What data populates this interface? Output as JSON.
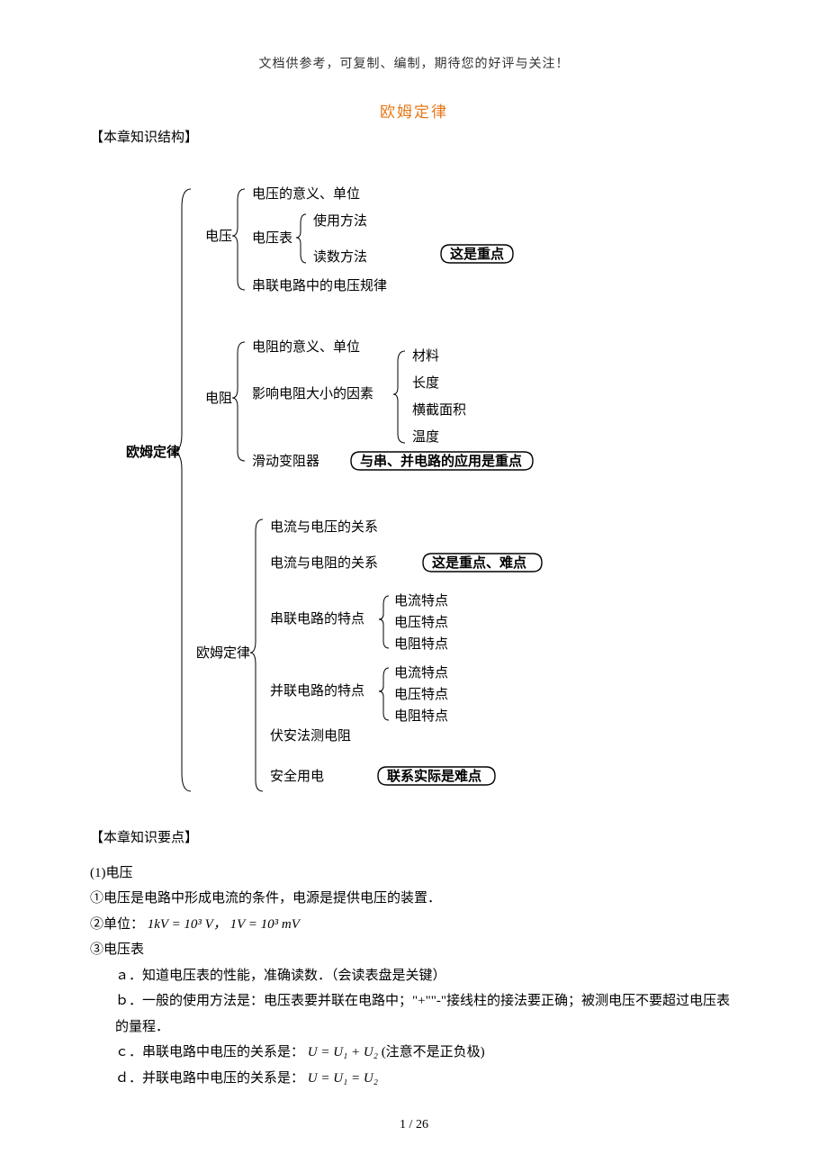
{
  "header_note": "文档供参考，可复制、编制，期待您的好评与关注！",
  "title": "欧姆定律",
  "section1_title": "【本章知识结构】",
  "diagram": {
    "root": "欧姆定律",
    "voltage": {
      "label": "电压",
      "item1": "电压的意义、单位",
      "meter_label": "电压表",
      "meter_a": "使用方法",
      "meter_b": "读数方法",
      "box1": "这是重点",
      "item3": "串联电路中的电压规律"
    },
    "resistance": {
      "label": "电阻",
      "item1": "电阻的意义、单位",
      "factors_label": "影响电阻大小的因素",
      "f1": "材料",
      "f2": "长度",
      "f3": "横截面积",
      "f4": "温度",
      "slider": "滑动变阻器",
      "box2": "与串、并电路的应用是重点"
    },
    "ohm": {
      "label": "欧姆定律",
      "rel1": "电流与电压的关系",
      "rel2": "电流与电阻的关系",
      "box3": "这是重点、难点",
      "series_label": "串联电路的特点",
      "parallel_label": "并联电路的特点",
      "p1": "电流特点",
      "p2": "电压特点",
      "p3": "电阻特点",
      "va": "伏安法测电阻",
      "safe": "安全用电",
      "box4": "联系实际是难点"
    }
  },
  "section2_title": "【本章知识要点】",
  "body": {
    "l1": "(1)电压",
    "l2": "①电压是电路中形成电流的条件，电源是提供电压的装置．",
    "l3_prefix": "②单位：",
    "l3_formula": "1kV = 10³ V， 1V = 10³ mV",
    "l4": "③电压表",
    "l5": "ａ．知道电压表的性能，准确读数．（会读表盘是关键）",
    "l6": "ｂ．一般的使用方法是：电压表要并联在电路中；\"+\"\"-\"接线柱的接法要正确；被测电压不要超过电压表的量程．",
    "l7_prefix": "ｃ．串联电路中电压的关系是：",
    "l7_formula": "U = U₁ + U₂",
    "l7_suffix": "(注意不是正负极)",
    "l8_prefix": "ｄ．并联电路中电压的关系是：",
    "l8_formula": "U = U₁ = U₂"
  },
  "page_cur": "1",
  "page_sep": " / ",
  "page_total": "26"
}
